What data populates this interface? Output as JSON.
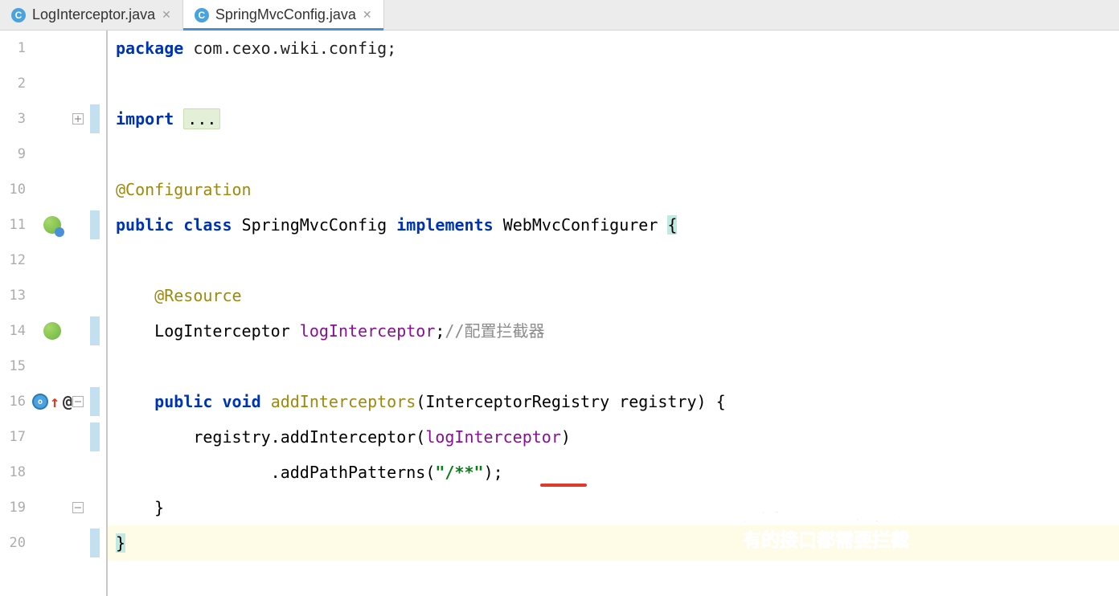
{
  "tabs": [
    {
      "label": "LogInterceptor.java",
      "active": false
    },
    {
      "label": "SpringMvcConfig.java",
      "active": true
    }
  ],
  "lineNumbers": [
    "1",
    "2",
    "3",
    "9",
    "10",
    "11",
    "12",
    "13",
    "14",
    "15",
    "16",
    "17",
    "18",
    "19",
    "20",
    ""
  ],
  "code": {
    "l1": {
      "kw": "package",
      "rest": " com.cexo.wiki.config;"
    },
    "l3": {
      "kw": "import",
      "fold": "..."
    },
    "l10": {
      "ann": "@Configuration"
    },
    "l11": {
      "kw1": "public",
      "kw2": "class",
      "type": "SpringMvcConfig",
      "kw3": "implements",
      "iface": "WebMvcConfigurer",
      "brace": "{"
    },
    "l13": {
      "ann": "@Resource"
    },
    "l14": {
      "type": "LogInterceptor",
      "field": "logInterceptor",
      "semi": ";",
      "comment": "//配置拦截器"
    },
    "l16": {
      "kw1": "public",
      "kw2": "void",
      "mname": "addInterceptors",
      "params": "(InterceptorRegistry registry) {"
    },
    "l17": {
      "obj": "registry",
      "m1": ".addInterceptor(",
      "arg": "logInterceptor",
      "close": ")"
    },
    "l18": {
      "m2": ".addPathPatterns(",
      "str": "\"/**\"",
      "close2": ");"
    },
    "l19": {
      "brace": "}"
    },
    "l20": {
      "brace": "}"
    }
  },
  "annotation": {
    "line1": "这个的意思是说针对所",
    "line2": "有的接口都需要拦截"
  }
}
